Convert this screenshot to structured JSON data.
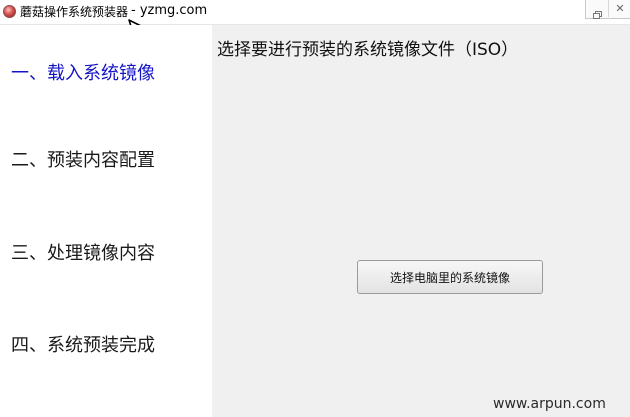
{
  "window": {
    "title": "蘑菇操作系统预装器",
    "site": "- yzmg.com",
    "app_icon": "mushroom-app-icon",
    "cursor_icon": "mouse-pointer-icon",
    "controls": [
      "restore-icon",
      "close-icon"
    ]
  },
  "sidebar": {
    "steps": [
      {
        "label": "一、载入系统镜像",
        "active": true
      },
      {
        "label": "二、预装内容配置",
        "active": false
      },
      {
        "label": "三、处理镜像内容",
        "active": false
      },
      {
        "label": "四、系统预装完成",
        "active": false
      }
    ]
  },
  "main": {
    "title": "选择要进行预装的系统镜像文件（ISO）",
    "button_label": "选择电脑里的系统镜像"
  },
  "watermark": "www.arpun.com",
  "colors": {
    "active_step": "#1515c8",
    "content_bg": "#f0f0f0",
    "sidebar_bg": "#ffffff"
  }
}
